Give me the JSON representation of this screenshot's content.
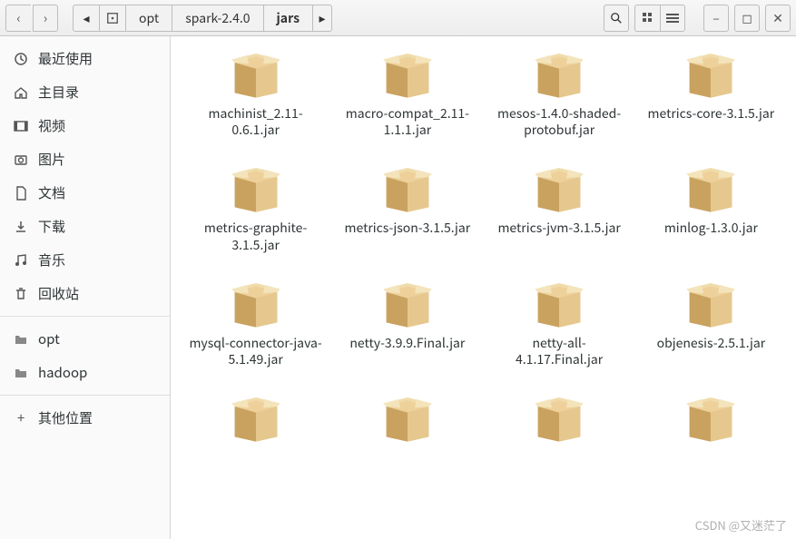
{
  "path": {
    "segments": [
      "opt",
      "spark-2.4.0",
      "jars"
    ],
    "current_index": 2
  },
  "sidebar": {
    "places": [
      {
        "icon": "clock",
        "label": "最近使用"
      },
      {
        "icon": "home",
        "label": "主目录"
      },
      {
        "icon": "video",
        "label": "视频"
      },
      {
        "icon": "photo",
        "label": "图片"
      },
      {
        "icon": "doc",
        "label": "文档"
      },
      {
        "icon": "download",
        "label": "下载"
      },
      {
        "icon": "music",
        "label": "音乐"
      },
      {
        "icon": "trash",
        "label": "回收站"
      }
    ],
    "bookmarks": [
      {
        "icon": "folder",
        "label": "opt"
      },
      {
        "icon": "folder",
        "label": "hadoop"
      }
    ],
    "other": {
      "icon": "plus",
      "label": "其他位置"
    }
  },
  "files": [
    {
      "name": "machinist_2.11-0.6.1.jar"
    },
    {
      "name": "macro-compat_2.11-1.1.1.jar"
    },
    {
      "name": "mesos-1.4.0-shaded-protobuf.jar"
    },
    {
      "name": "metrics-core-3.1.5.jar"
    },
    {
      "name": "metrics-graphite-3.1.5.jar"
    },
    {
      "name": "metrics-json-3.1.5.jar"
    },
    {
      "name": "metrics-jvm-3.1.5.jar"
    },
    {
      "name": "minlog-1.3.0.jar"
    },
    {
      "name": "mysql-connector-java-5.1.49.jar"
    },
    {
      "name": "netty-3.9.9.Final.jar"
    },
    {
      "name": "netty-all-4.1.17.Final.jar"
    },
    {
      "name": "objenesis-2.5.1.jar"
    },
    {
      "name": ""
    },
    {
      "name": ""
    },
    {
      "name": ""
    },
    {
      "name": ""
    }
  ],
  "watermark": "CSDN @又迷茫了"
}
